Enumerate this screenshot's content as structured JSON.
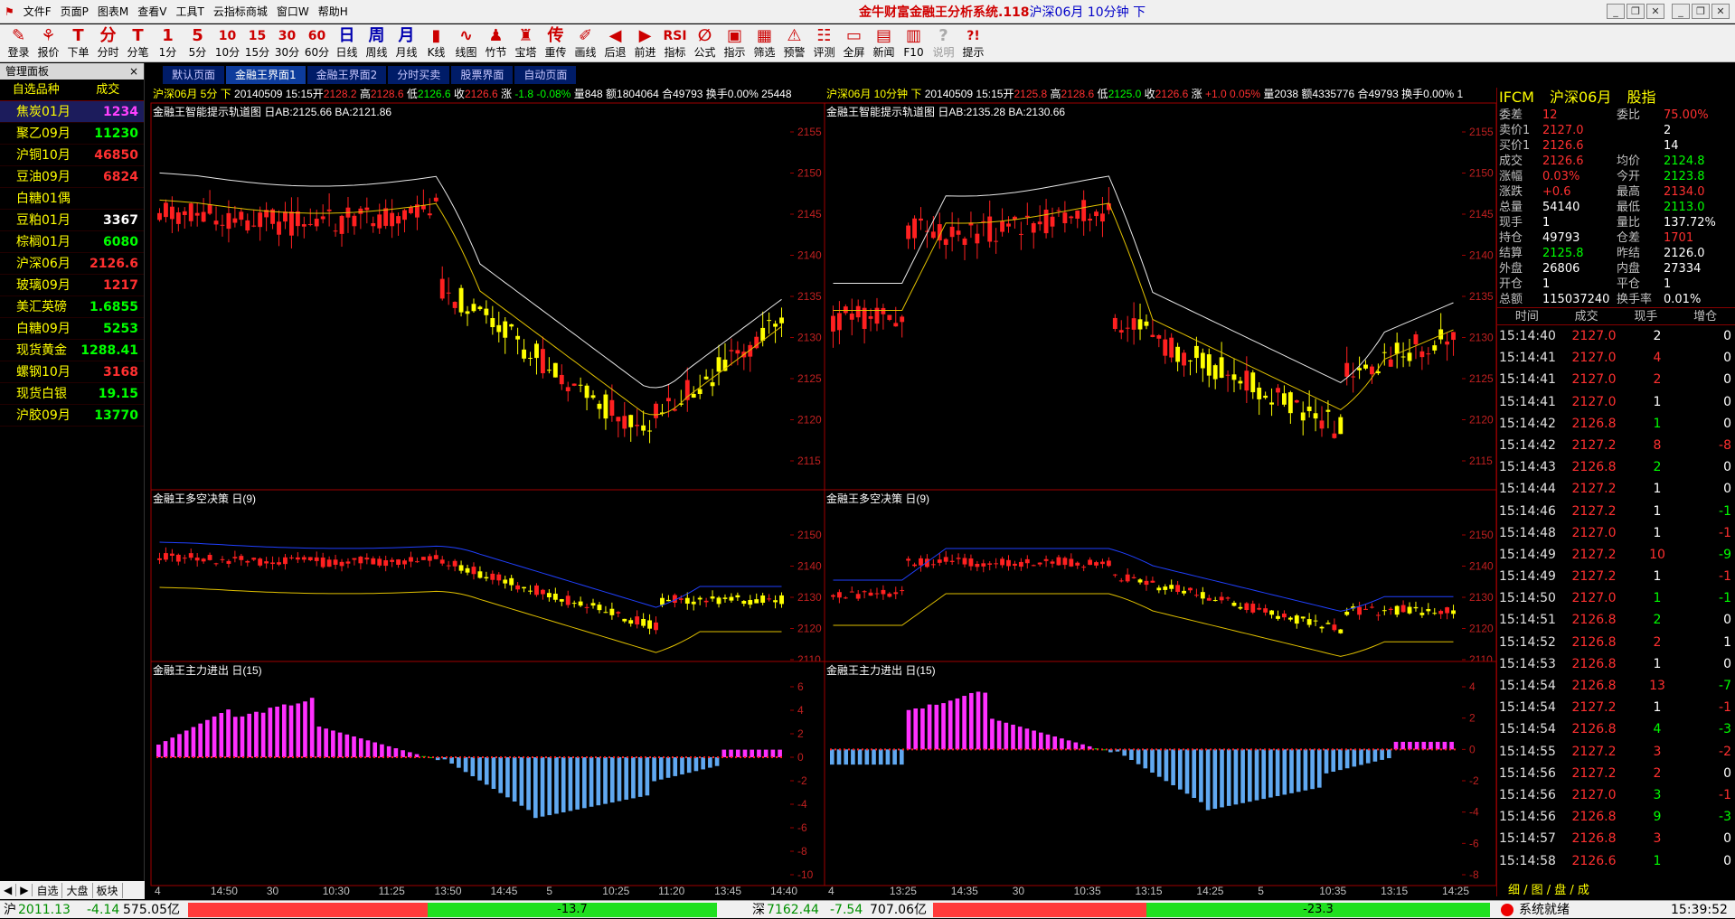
{
  "menu": [
    "文件F",
    "页面P",
    "图表M",
    "查看V",
    "工具T",
    "云指标商城",
    "窗口W",
    "帮助H"
  ],
  "app_title": "金牛财富金融王分析系统.118",
  "app_subtitle": "沪深06月 10分钟 下",
  "toolbar": [
    {
      "icon": "person-icon",
      "glyph": "✎",
      "label": "登录"
    },
    {
      "icon": "quote-icon",
      "glyph": "⚘",
      "label": "报价"
    },
    {
      "icon": "order-icon",
      "glyph": "T",
      "label": "下单"
    },
    {
      "icon": "minute-icon",
      "glyph": "分",
      "label": "分时"
    },
    {
      "icon": "tick-icon",
      "glyph": "T",
      "label": "分笔"
    },
    {
      "icon": "1min-icon",
      "glyph": "1",
      "label": "1分"
    },
    {
      "icon": "5min-icon",
      "glyph": "5",
      "label": "5分"
    },
    {
      "icon": "10min-icon",
      "glyph": "10",
      "label": "10分"
    },
    {
      "icon": "15min-icon",
      "glyph": "15",
      "label": "15分"
    },
    {
      "icon": "30min-icon",
      "glyph": "30",
      "label": "30分"
    },
    {
      "icon": "60min-icon",
      "glyph": "60",
      "label": "60分"
    },
    {
      "icon": "day-icon",
      "glyph": "日",
      "label": "日线"
    },
    {
      "icon": "week-icon",
      "glyph": "周",
      "label": "周线"
    },
    {
      "icon": "month-icon",
      "glyph": "月",
      "label": "月线"
    },
    {
      "icon": "kline-icon",
      "glyph": "▮",
      "label": "K线"
    },
    {
      "icon": "line-chart-icon",
      "glyph": "∿",
      "label": "线图"
    },
    {
      "icon": "bamboo-icon",
      "glyph": "♟",
      "label": "竹节"
    },
    {
      "icon": "tower-icon",
      "glyph": "♜",
      "label": "宝塔"
    },
    {
      "icon": "repeat-icon",
      "glyph": "传",
      "label": "重传"
    },
    {
      "icon": "draw-line-icon",
      "glyph": "✐",
      "label": "画线"
    },
    {
      "icon": "back-icon",
      "glyph": "◀",
      "label": "后退"
    },
    {
      "icon": "forward-icon",
      "glyph": "▶",
      "label": "前进"
    },
    {
      "icon": "indicator-icon",
      "glyph": "RSI",
      "label": "指标"
    },
    {
      "icon": "formula-icon",
      "glyph": "∅",
      "label": "公式"
    },
    {
      "icon": "hint-icon",
      "glyph": "▣",
      "label": "指示"
    },
    {
      "icon": "filter-icon",
      "glyph": "▦",
      "label": "筛选"
    },
    {
      "icon": "alert-icon",
      "glyph": "⚠",
      "label": "预警"
    },
    {
      "icon": "evaluate-icon",
      "glyph": "☷",
      "label": "评测"
    },
    {
      "icon": "fullscreen-icon",
      "glyph": "▭",
      "label": "全屏"
    },
    {
      "icon": "news-icon",
      "glyph": "▤",
      "label": "新闻"
    },
    {
      "icon": "f10-icon",
      "glyph": "▥",
      "label": "F10"
    },
    {
      "icon": "help-icon",
      "glyph": "?",
      "label": "说明",
      "disabled": true
    },
    {
      "icon": "tip-icon",
      "glyph": "?!",
      "label": "提示"
    }
  ],
  "left_panel": {
    "title": "管理面板",
    "close": "×",
    "col_name": "自选品种",
    "col_value": "成交",
    "items": [
      {
        "name": "焦炭01月",
        "value": "1234",
        "color": "#ff40ff",
        "selected": true
      },
      {
        "name": "聚乙09月",
        "value": "11230",
        "color": "#00ff00"
      },
      {
        "name": "沪铜10月",
        "value": "46850",
        "color": "#ff3030"
      },
      {
        "name": "豆油09月",
        "value": "6824",
        "color": "#ff3030"
      },
      {
        "name": "白糖01偶",
        "value": "",
        "color": "#ffffff"
      },
      {
        "name": "豆粕01月",
        "value": "3367",
        "color": "#ffffff"
      },
      {
        "name": "棕榈01月",
        "value": "6080",
        "color": "#00ff00"
      },
      {
        "name": "沪深06月",
        "value": "2126.6",
        "color": "#ff3030"
      },
      {
        "name": "玻璃09月",
        "value": "1217",
        "color": "#ff3030"
      },
      {
        "name": "美汇英磅",
        "value": "1.6855",
        "color": "#00ff00"
      },
      {
        "name": "白糖09月",
        "value": "5253",
        "color": "#00ff00"
      },
      {
        "name": "现货黄金",
        "value": "1288.41",
        "color": "#00ff00"
      },
      {
        "name": "螺钢10月",
        "value": "3168",
        "color": "#ff3030"
      },
      {
        "name": "现货白银",
        "value": "19.15",
        "color": "#00ff00"
      },
      {
        "name": "沪胶09月",
        "value": "13770",
        "color": "#00ff00"
      }
    ],
    "tabs": [
      "自选",
      "大盘",
      "板块"
    ]
  },
  "tabs": [
    "默认页面",
    "金融王界面1",
    "金融王界面2",
    "分时买卖",
    "股票界面",
    "自动页面"
  ],
  "active_tab": 1,
  "left_chart": {
    "header": [
      {
        "t": "沪深06月 5分 下",
        "c": "#ffff00"
      },
      {
        "t": " 20140509 15:15开",
        "c": "#ffffff"
      },
      {
        "t": "2128.2",
        "c": "#ff3030"
      },
      {
        "t": " 高",
        "c": "#ffffff"
      },
      {
        "t": "2128.6",
        "c": "#ff3030"
      },
      {
        "t": " 低",
        "c": "#ffffff"
      },
      {
        "t": "2126.6",
        "c": "#00ff00"
      },
      {
        "t": " 收",
        "c": "#ffffff"
      },
      {
        "t": "2126.6",
        "c": "#ff3030"
      },
      {
        "t": " 涨 ",
        "c": "#ffffff"
      },
      {
        "t": "-1.8 -0.08%",
        "c": "#00ff00"
      },
      {
        "t": " 量848 额1804064 合49793 换手0.00% 25448",
        "c": "#ffffff"
      }
    ],
    "ind1_title": "金融王智能提示轨道图 日AB:2125.66 BA:2121.86",
    "ind2_title": "金融王多空决策 日(9)",
    "ind3_title": "金融王主力进出 日(15)",
    "price_ticks": [
      "2155",
      "2150",
      "2145",
      "2140",
      "2135",
      "2130",
      "2125",
      "2120",
      "2115"
    ],
    "mid_ticks": [
      "2150",
      "2140",
      "2130",
      "2120",
      "2110"
    ],
    "bot_ticks": [
      "6",
      "4",
      "2",
      "0",
      "-2",
      "-4",
      "-6",
      "-8",
      "-10"
    ],
    "time_ticks": [
      "4",
      "14:50",
      "30",
      "10:30",
      "11:25",
      "13:50",
      "14:45",
      "5",
      "10:25",
      "11:20",
      "13:45",
      "14:40"
    ]
  },
  "right_chart": {
    "header": [
      {
        "t": "沪深06月 10分钟 下",
        "c": "#ffff00"
      },
      {
        "t": " 20140509 15:15开",
        "c": "#ffffff"
      },
      {
        "t": "2125.8",
        "c": "#ff3030"
      },
      {
        "t": " 高",
        "c": "#ffffff"
      },
      {
        "t": "2128.6",
        "c": "#ff3030"
      },
      {
        "t": " 低",
        "c": "#ffffff"
      },
      {
        "t": "2125.0",
        "c": "#00ff00"
      },
      {
        "t": " 收",
        "c": "#ffffff"
      },
      {
        "t": "2126.6",
        "c": "#ff3030"
      },
      {
        "t": " 涨 ",
        "c": "#ffffff"
      },
      {
        "t": "+1.0 0.05%",
        "c": "#ff3030"
      },
      {
        "t": " 量2038 额4335776 合49793 换手0.00% 1",
        "c": "#ffffff"
      }
    ],
    "ind1_title": "金融王智能提示轨道图 日AB:2135.28 BA:2130.66",
    "ind2_title": "金融王多空决策 日(9)",
    "ind3_title": "金融王主力进出 日(15)",
    "price_ticks": [
      "2155",
      "2150",
      "2145",
      "2140",
      "2135",
      "2130",
      "2125",
      "2120",
      "2115"
    ],
    "mid_ticks": [
      "2150",
      "2140",
      "2130",
      "2120",
      "2110"
    ],
    "bot_ticks": [
      "4",
      "2",
      "0",
      "-2",
      "-4",
      "-6",
      "-8"
    ],
    "time_ticks": [
      "4",
      "13:25",
      "14:35",
      "30",
      "10:35",
      "13:15",
      "14:25",
      "5",
      "10:35",
      "13:15",
      "14:25"
    ]
  },
  "quote": {
    "code": "IFCM",
    "name": "沪深06月",
    "kind": "股指",
    "rows": [
      [
        "委差",
        "12",
        "#ff3030",
        "委比",
        "75.00%",
        "#ff3030"
      ],
      [
        "卖价1",
        "2127.0",
        "#ff3030",
        "",
        "2",
        "#ffffff"
      ],
      [
        "买价1",
        "2126.6",
        "#ff3030",
        "",
        "14",
        "#ffffff"
      ],
      [
        "成交",
        "2126.6",
        "#ff3030",
        "均价",
        "2124.8",
        "#00ff00"
      ],
      [
        "涨幅",
        "0.03%",
        "#ff3030",
        "今开",
        "2123.8",
        "#00ff00"
      ],
      [
        "涨跌",
        "+0.6",
        "#ff3030",
        "最高",
        "2134.0",
        "#ff3030"
      ],
      [
        "总量",
        "54140",
        "#ffffff",
        "最低",
        "2113.0",
        "#00ff00"
      ],
      [
        "现手",
        "1",
        "#ffffff",
        "量比",
        "137.72%",
        "#ffffff"
      ],
      [
        "持仓",
        "49793",
        "#ffffff",
        "仓差",
        "1701",
        "#ff3030"
      ],
      [
        "结算",
        "2125.8",
        "#00ff00",
        "昨结",
        "2126.0",
        "#ffffff"
      ],
      [
        "外盘",
        "26806",
        "#ffffff",
        "内盘",
        "27334",
        "#ffffff"
      ],
      [
        "开仓",
        "1",
        "#ffffff",
        "平仓",
        "1",
        "#ffffff"
      ],
      [
        "总额",
        "115037240",
        "#ffffff",
        "换手率",
        "0.01%",
        "#ffffff"
      ]
    ],
    "tick_cols": [
      "时间",
      "成交",
      "现手",
      "增仓"
    ],
    "ticks": [
      [
        "15:14:40",
        "2127.0",
        "2",
        "0",
        "#ff3030"
      ],
      [
        "15:14:41",
        "2127.0",
        "4",
        "0",
        "#ff3030"
      ],
      [
        "15:14:41",
        "2127.0",
        "2",
        "0",
        "#ff3030"
      ],
      [
        "15:14:41",
        "2127.0",
        "1",
        "0",
        "#ff3030"
      ],
      [
        "15:14:42",
        "2126.8",
        "1",
        "0",
        "#ff3030"
      ],
      [
        "15:14:42",
        "2127.2",
        "8",
        "-8",
        "#ff3030"
      ],
      [
        "15:14:43",
        "2126.8",
        "2",
        "0",
        "#ff3030"
      ],
      [
        "15:14:44",
        "2127.2",
        "1",
        "0",
        "#ff3030"
      ],
      [
        "15:14:46",
        "2127.2",
        "1",
        "-1",
        "#ff3030"
      ],
      [
        "15:14:48",
        "2127.0",
        "1",
        "-1",
        "#ff3030"
      ],
      [
        "15:14:49",
        "2127.2",
        "10",
        "-9",
        "#ff3030"
      ],
      [
        "15:14:49",
        "2127.2",
        "1",
        "-1",
        "#ff3030"
      ],
      [
        "15:14:50",
        "2127.0",
        "1",
        "-1",
        "#ff3030"
      ],
      [
        "15:14:51",
        "2126.8",
        "2",
        "0",
        "#ff3030"
      ],
      [
        "15:14:52",
        "2126.8",
        "2",
        "1",
        "#ff3030"
      ],
      [
        "15:14:53",
        "2126.8",
        "1",
        "0",
        "#ff3030"
      ],
      [
        "15:14:54",
        "2126.8",
        "13",
        "-7",
        "#ff3030"
      ],
      [
        "15:14:54",
        "2127.2",
        "1",
        "-1",
        "#ff3030"
      ],
      [
        "15:14:54",
        "2126.8",
        "4",
        "-3",
        "#ff3030"
      ],
      [
        "15:14:55",
        "2127.2",
        "3",
        "-2",
        "#ff3030"
      ],
      [
        "15:14:56",
        "2127.2",
        "2",
        "0",
        "#ff3030"
      ],
      [
        "15:14:56",
        "2127.0",
        "3",
        "-1",
        "#ff3030"
      ],
      [
        "15:14:56",
        "2126.8",
        "9",
        "-3",
        "#ff3030"
      ],
      [
        "15:14:57",
        "2126.8",
        "3",
        "0",
        "#ff3030"
      ],
      [
        "15:14:58",
        "2126.6",
        "1",
        "0",
        "#ff3030"
      ]
    ],
    "tabs": "细 / 图 / 盘 / 成"
  },
  "status": {
    "sh_label": "沪",
    "sh_index": "2011.13",
    "sh_change": "-4.14",
    "sh_amount": "575.05亿",
    "sh_bar": "-13.7",
    "sz_label": "深",
    "sz_index": "7162.44",
    "sz_change": "-7.54",
    "sz_amount": "707.06亿",
    "sz_bar": "-23.3",
    "ready": "系统就绪",
    "clock": "15:39:52"
  }
}
